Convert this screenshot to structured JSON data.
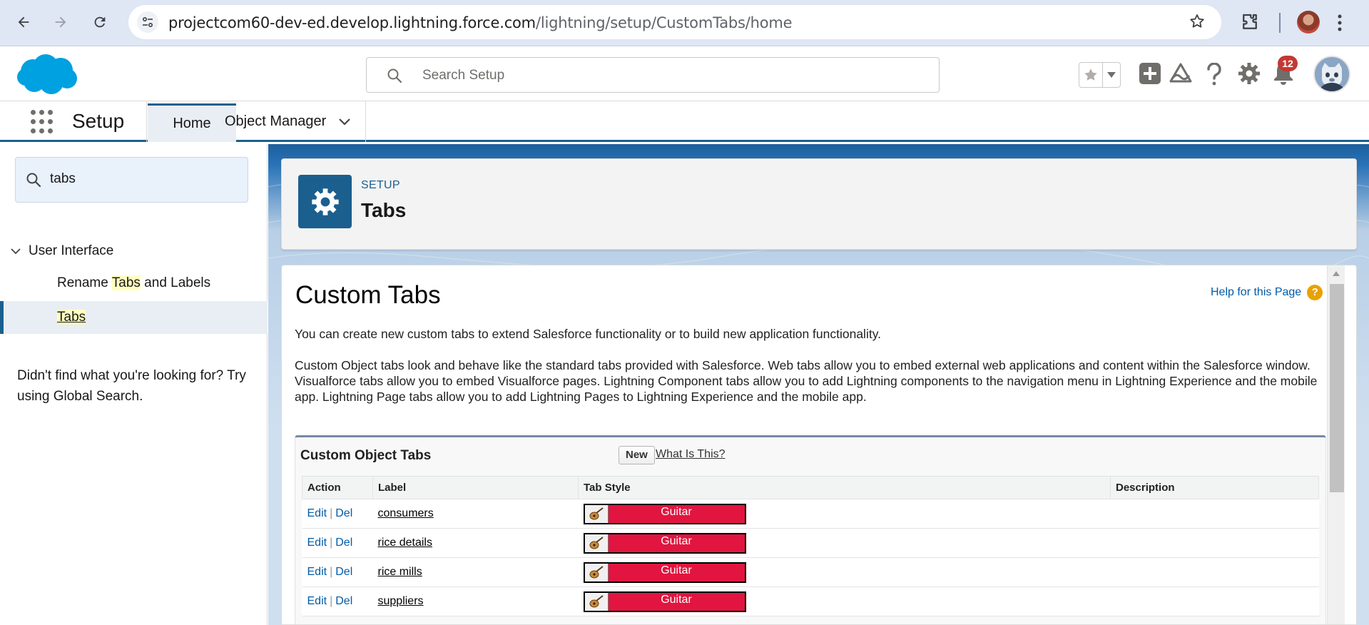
{
  "browser": {
    "url_host": "projectcom60-dev-ed.develop.lightning.force.com",
    "url_path": "/lightning/setup/CustomTabs/home"
  },
  "header": {
    "search_placeholder": "Search Setup",
    "notification_count": "12",
    "brand_color": "#00a1e0"
  },
  "appnav": {
    "app_name": "Setup",
    "tabs": [
      {
        "label": "Home"
      },
      {
        "label": "Object Manager"
      }
    ]
  },
  "sidebar": {
    "quickfind_value": "tabs",
    "tree": {
      "group_label": "User Interface",
      "items": [
        {
          "pre": "Rename ",
          "highlight": "Tabs",
          "post": " and Labels"
        },
        {
          "pre": "",
          "highlight": "Tabs",
          "post": ""
        }
      ]
    },
    "help_note": "Didn't find what you're looking for? Try using Global Search."
  },
  "page_header": {
    "eyebrow": "SETUP",
    "title": "Tabs"
  },
  "content": {
    "title": "Custom Tabs",
    "help_link": "Help for this Page",
    "help_icon": "?",
    "intro": "You can create new custom tabs to extend Salesforce functionality or to build new application functionality.",
    "detail": "Custom Object tabs look and behave like the standard tabs provided with Salesforce. Web tabs allow you to embed external web applications and content within the Salesforce window. Visualforce tabs allow you to embed Visualforce pages. Lightning Component tabs allow you to add Lightning components to the navigation menu in Lightning Experience and the mobile app. Lightning Page tabs allow you to add Lightning Pages to Lightning Experience and the mobile app."
  },
  "custom_object_tabs": {
    "title": "Custom Object Tabs",
    "new_button": "New",
    "what_is_this": "What Is This?",
    "columns": [
      "Action",
      "Label",
      "Tab Style",
      "Description"
    ],
    "edit_label": "Edit",
    "del_label": "Del",
    "separator": "|",
    "style_color": "#e1153f",
    "rows": [
      {
        "label": "consumers",
        "style": "Guitar",
        "description": ""
      },
      {
        "label": "rice details",
        "style": "Guitar",
        "description": ""
      },
      {
        "label": "rice mills",
        "style": "Guitar",
        "description": ""
      },
      {
        "label": "suppliers",
        "style": "Guitar",
        "description": ""
      }
    ]
  }
}
